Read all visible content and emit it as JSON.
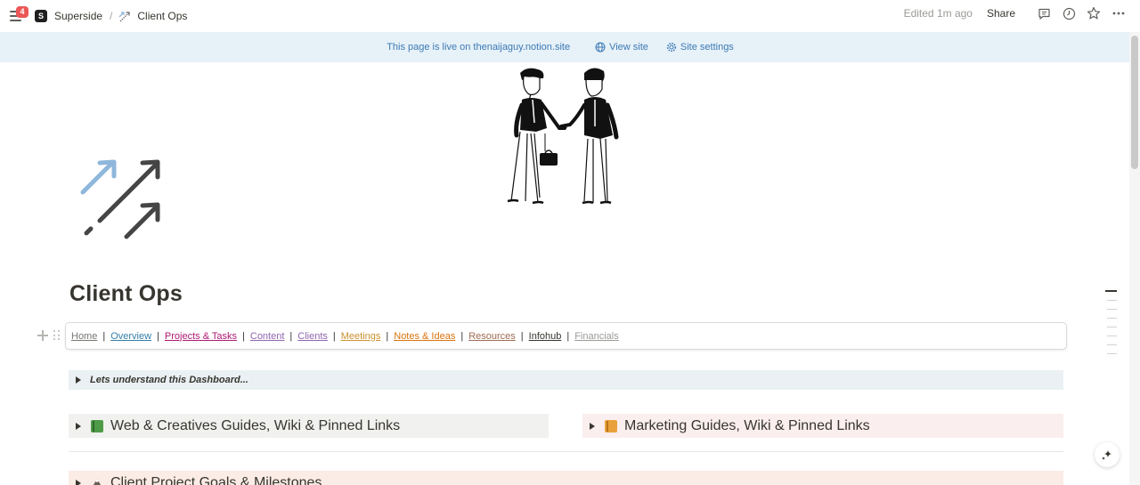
{
  "topbar": {
    "notification_count": "4",
    "workspace_icon_letter": "S",
    "workspace_name": "Superside",
    "page_name": "Client Ops",
    "edited": "Edited 1m ago",
    "share_label": "Share",
    "icons": [
      "menu-icon",
      "comment-icon",
      "clock-icon",
      "star-icon",
      "more-icon"
    ]
  },
  "banner": {
    "text": "This page is live on thenaijaguy.notion.site",
    "view_site": "View site",
    "site_settings": "Site settings"
  },
  "page": {
    "title": "Client Ops",
    "cover": "handshake-illustration",
    "icon": "arrows-up-right-icon"
  },
  "nav": {
    "items": [
      {
        "label": "Home",
        "color": "#787774"
      },
      {
        "label": "Overview",
        "color": "#337ea9"
      },
      {
        "label": "Projects & Tasks",
        "color": "#ad1a72"
      },
      {
        "label": "Content",
        "color": "#9065b0"
      },
      {
        "label": "Clients",
        "color": "#9065b0"
      },
      {
        "label": "Meetings",
        "color": "#cb912f"
      },
      {
        "label": "Notes & Ideas",
        "color": "#d9730d"
      },
      {
        "label": "Resources",
        "color": "#9f6b53"
      },
      {
        "label": "Infohub",
        "color": "#37352f"
      },
      {
        "label": "Financials",
        "color": "#9b9a97"
      }
    ]
  },
  "toggles": {
    "dashboard": "Lets understand this Dashboard...",
    "web": "Web & Creatives Guides, Wiki & Pinned Links",
    "marketing": "Marketing Guides, Wiki & Pinned Links",
    "goals": "Client Project Goals & Milestones"
  },
  "colors": {
    "banner_bg": "#e7f1f8",
    "banner_text": "#3c7ab5",
    "web_book": "#4f9a47",
    "marketing_book": "#e9a23b"
  }
}
